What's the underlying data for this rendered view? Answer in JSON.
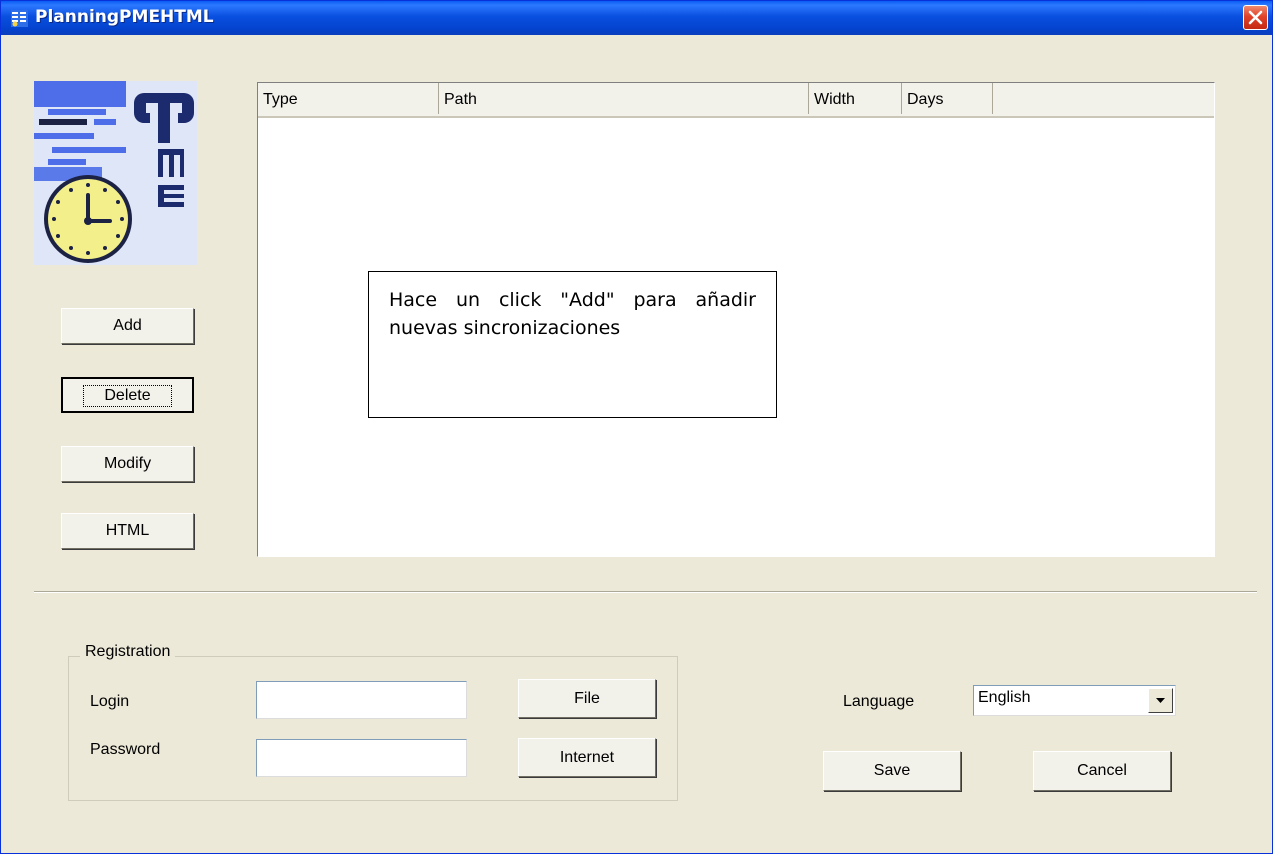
{
  "window": {
    "title": "PlanningPMEHTML"
  },
  "actions": {
    "add": "Add",
    "delete": "Delete",
    "modify": "Modify",
    "html": "HTML"
  },
  "list": {
    "columns": [
      "Type",
      "Path",
      "Width",
      "Days"
    ],
    "rows": []
  },
  "hint": "Hace un click \"Add\" para añadir nuevas sincronizaciones",
  "registration": {
    "title": "Registration",
    "login_label": "Login",
    "login_value": "",
    "password_label": "Password",
    "password_value": "",
    "file_button": "File",
    "internet_button": "Internet"
  },
  "language": {
    "label": "Language",
    "selected": "English"
  },
  "footer": {
    "save": "Save",
    "cancel": "Cancel"
  },
  "icons": {
    "app": "app-list-icon",
    "close": "close-icon",
    "dropdown": "chevron-down-icon",
    "logo": "pme-clock-logo"
  },
  "colors": {
    "title_bar": "#0a50e0",
    "close_button": "#e0432a",
    "dialog_background": "#ece9d8"
  }
}
